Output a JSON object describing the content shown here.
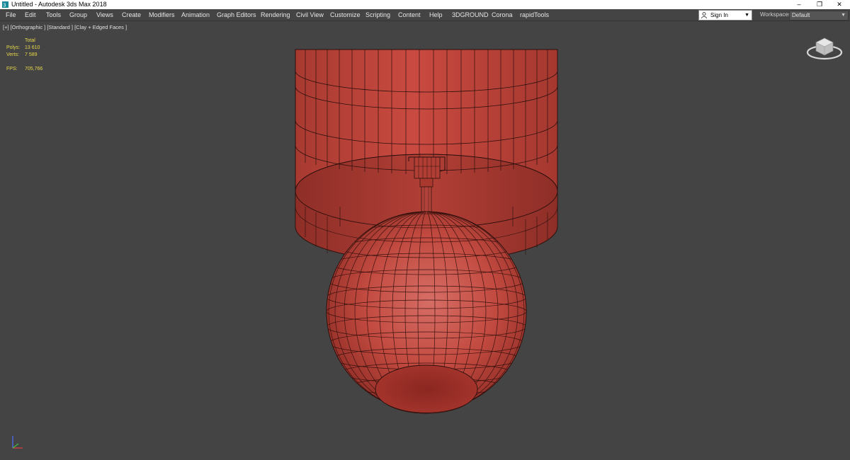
{
  "window": {
    "title": "Untitled - Autodesk 3ds Max 2018",
    "controls": [
      "–",
      "❐",
      "✕"
    ]
  },
  "menu": {
    "items": [
      "File",
      "Edit",
      "Tools",
      "Group",
      "Views",
      "Create",
      "Modifiers",
      "Animation",
      "Graph Editors",
      "Rendering",
      "Civil View",
      "Customize",
      "Scripting",
      "Content",
      "Help",
      "3DGROUND",
      "Corona",
      "rapidTools"
    ]
  },
  "account": {
    "sign_in": "Sign In"
  },
  "workspaces": {
    "label": "Workspaces:",
    "value": "Default"
  },
  "viewport": {
    "label": "[+] [Orthographic ] [Standard ] [Clay + Edged Faces ]",
    "stats": {
      "header": "Total",
      "polys_label": "Polys:",
      "polys_value": "13 610",
      "verts_label": "Verts:",
      "verts_value": "7 589",
      "fps_label": "FPS:",
      "fps_value": "705,766"
    }
  },
  "colors": {
    "viewport_bg": "#444444",
    "clay": "#c2473d",
    "stats_text": "#e8d84a"
  },
  "icons": {
    "app": "3dsmax-app-icon",
    "user": "user-icon",
    "viewcube": "viewcube-icon",
    "axis": "axis-tripod-icon"
  }
}
